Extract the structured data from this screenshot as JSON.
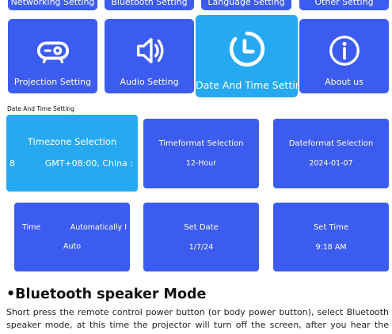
{
  "top_row": [
    {
      "label": "Networking Setting"
    },
    {
      "label": "Bluetooth Setting"
    },
    {
      "label": "Language Setting"
    },
    {
      "label": "Other Setting"
    }
  ],
  "settings_row": [
    {
      "label": "Projection Setting",
      "icon": "projector-icon"
    },
    {
      "label": "Audio Setting",
      "icon": "speaker-icon"
    },
    {
      "label": "Date And Time Setting",
      "icon": "clock-icon",
      "selected": true
    },
    {
      "label": "About us",
      "icon": "info-icon"
    }
  ],
  "section_caption": "Date And Time Setting",
  "options": {
    "timezone": {
      "title": "Timezone Selection",
      "left_fragment": "8",
      "value": "GMT+08:00, China :"
    },
    "timeformat": {
      "title": "Timeformat Selection",
      "value": "12-Hour"
    },
    "dateformat": {
      "title": "Dateformat Selection",
      "value": "2024-01-07"
    },
    "time": {
      "title": "Time",
      "title_right": "Automatically I",
      "value": "Auto"
    },
    "set_date": {
      "title": "Set Date",
      "value": "1/7/24"
    },
    "set_time": {
      "title": "Set Time",
      "value": "9:18 AM"
    }
  },
  "manual": {
    "heading": "•Bluetooth speaker Mode",
    "body": "Short press the remote control power button (or body power button), select Bluetooth speaker mode, at this time the projector will turn off the screen, after you hear the beep, Bluetooth"
  },
  "colors": {
    "tile": "#3c5cf0",
    "selected_tile": "#27a9f2",
    "text": "#ffffff"
  }
}
